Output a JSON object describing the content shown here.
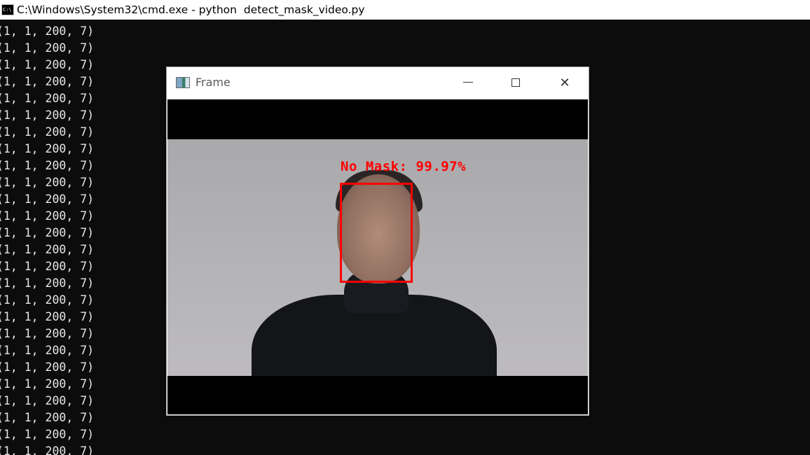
{
  "console": {
    "title": "C:\\Windows\\System32\\cmd.exe - python  detect_mask_video.py",
    "icon": "cmd-icon",
    "icon_text": "C:\\",
    "lines": [
      "(1, 1, 200, 7)",
      "(1, 1, 200, 7)",
      "(1, 1, 200, 7)",
      "(1, 1, 200, 7)",
      "(1, 1, 200, 7)",
      "(1, 1, 200, 7)",
      "(1, 1, 200, 7)",
      "(1, 1, 200, 7)",
      "(1, 1, 200, 7)",
      "(1, 1, 200, 7)",
      "(1, 1, 200, 7)",
      "(1, 1, 200, 7)",
      "(1, 1, 200, 7)",
      "(1, 1, 200, 7)",
      "(1, 1, 200, 7)",
      "(1, 1, 200, 7)",
      "(1, 1, 200, 7)",
      "(1, 1, 200, 7)",
      "(1, 1, 200, 7)",
      "(1, 1, 200, 7)",
      "(1, 1, 200, 7)",
      "(1, 1, 200, 7)",
      "(1, 1, 200, 7)",
      "(1, 1, 200, 7)",
      "(1, 1, 200, 7)",
      "(1, 1, 200, 7)"
    ]
  },
  "frame_window": {
    "title": "Frame",
    "icon": "app-window-icon",
    "buttons": {
      "minimize_icon": "minimize-icon",
      "maximize_icon": "maximize-icon",
      "close_icon": "close-icon",
      "close_glyph": "✕"
    },
    "detection": {
      "label": "No Mask: 99.97%",
      "color": "#ff0000"
    }
  },
  "colors": {
    "console_bg": "#0c0c0c",
    "console_text": "#e6e6e6",
    "detection": "#ff0000"
  }
}
